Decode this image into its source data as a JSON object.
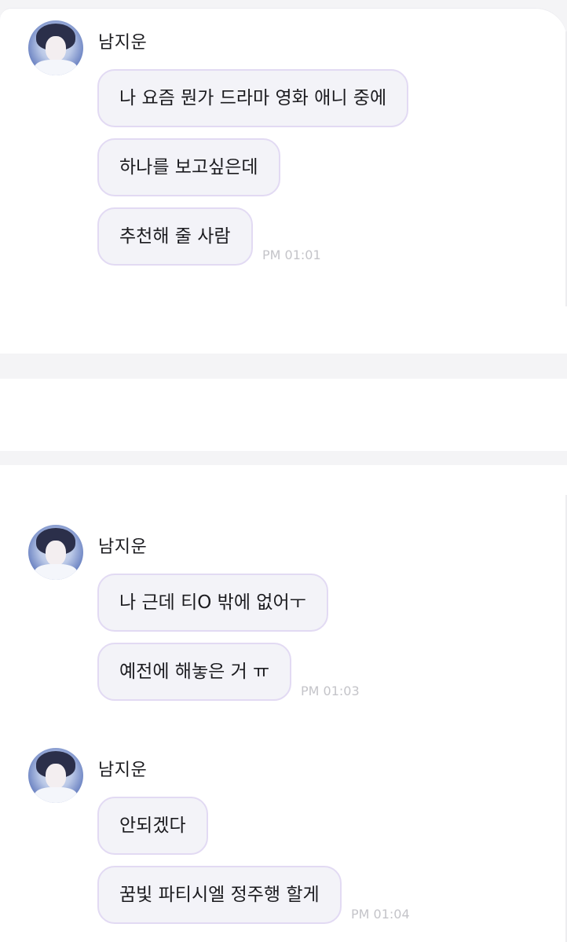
{
  "groups": [
    {
      "sender": "남지운",
      "messages": [
        "나 요즘 뭔가 드라마 영화 애니 중에",
        "하나를 보고싶은데",
        "추천해 줄 사람"
      ],
      "time": "PM 01:01"
    },
    {
      "sender": "남지운",
      "messages": [
        "나 근데 티O 밖에 없어ㅜ",
        "예전에 해놓은 거 ㅠ"
      ],
      "time": "PM 01:03"
    },
    {
      "sender": "남지운",
      "messages": [
        "안되겠다",
        "꿈빛 파티시엘 정주행 할게"
      ],
      "time": "PM 01:04"
    }
  ],
  "colors": {
    "bubble_bg": "#f3f3f8",
    "bubble_border": "#e2daf3",
    "time_text": "#c4c4c9"
  }
}
